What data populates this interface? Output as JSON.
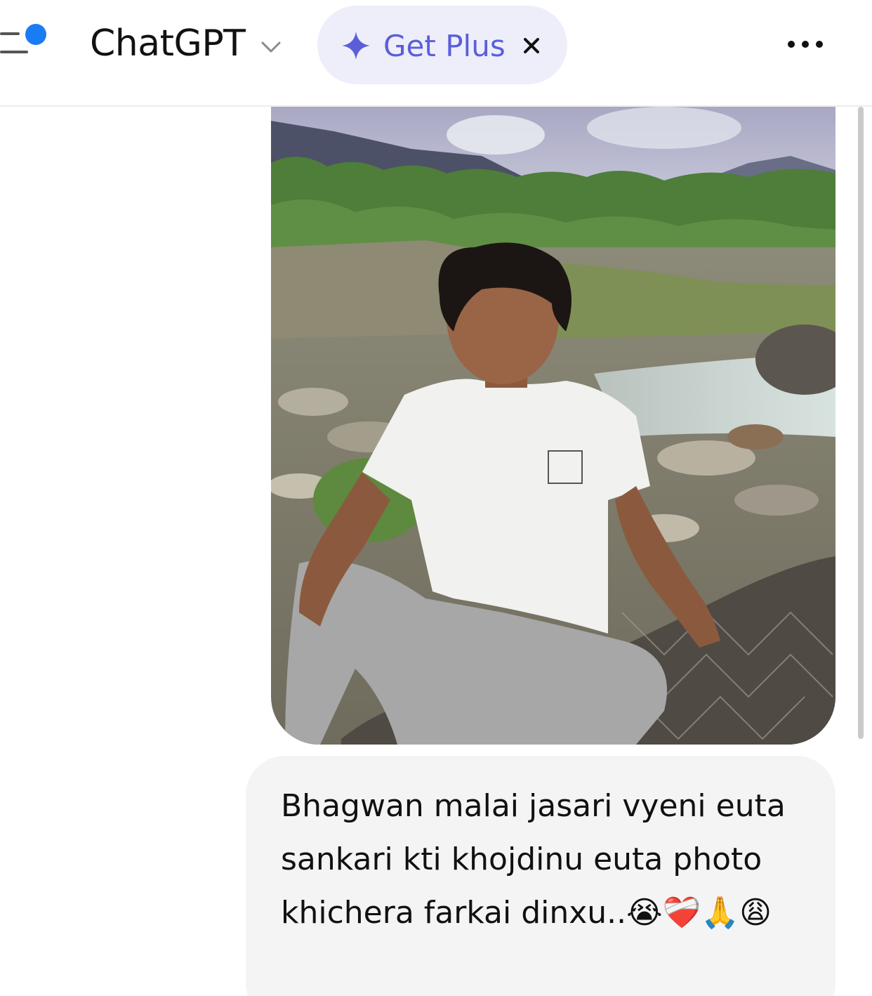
{
  "header": {
    "title": "ChatGPT",
    "upgrade_label": "Get Plus",
    "icons": {
      "menu": "sidebar-menu-icon",
      "chevron": "chevron-down-icon",
      "sparkle": "sparkle-icon",
      "close": "close-icon",
      "more": "more-options-icon"
    },
    "colors": {
      "accent": "#5a5fd9",
      "pill_bg": "#eeeefb",
      "notification_dot": "#1a7cf5"
    }
  },
  "conversation": {
    "messages": [
      {
        "role": "user",
        "type": "image",
        "image_description_icon": "uploaded-photo"
      },
      {
        "role": "user",
        "type": "text",
        "text": "Bhagwan malai jasari vyeni euta sankari kti khojdinu euta photo khichera farkai dinxu..😭❤️‍🩹🙏😩"
      }
    ]
  }
}
